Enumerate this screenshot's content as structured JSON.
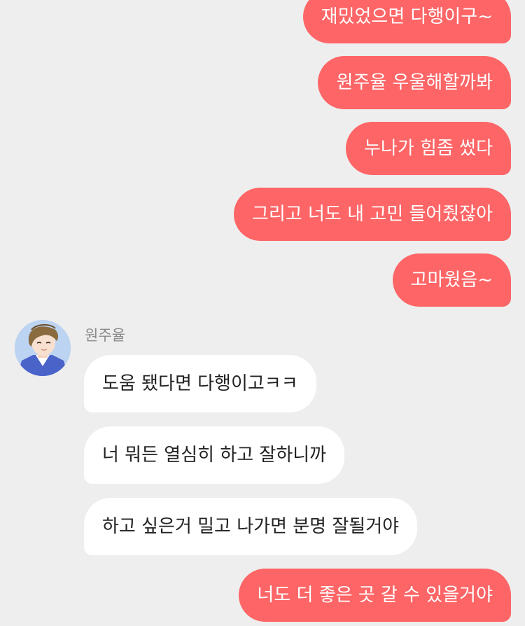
{
  "conversation": {
    "sender_name": "원주율",
    "messages": [
      {
        "direction": "out",
        "text": "재밌었으면 다행이구~"
      },
      {
        "direction": "out",
        "text": "원주율 우울해할까봐"
      },
      {
        "direction": "out",
        "text": "누나가 힘좀 썼다"
      },
      {
        "direction": "out",
        "text": "그리고 너도 내 고민 들어줬잖아"
      },
      {
        "direction": "out",
        "text": "고마웠음~"
      },
      {
        "direction": "in",
        "text": "도움 됐다면 다행이고ㅋㅋ"
      },
      {
        "direction": "in",
        "text": "너 뭐든 열심히 하고 잘하니까"
      },
      {
        "direction": "in",
        "text": "하고 싶은거 밀고 나가면 분명 잘될거야"
      },
      {
        "direction": "out",
        "text": "너도 더 좋은 곳 갈 수 있을거야"
      }
    ]
  },
  "colors": {
    "background": "#eeeeee",
    "outgoing_bubble": "#fd6566",
    "incoming_bubble": "#ffffff"
  },
  "icons": {
    "avatar": "profile-avatar-illustrated-boy"
  }
}
